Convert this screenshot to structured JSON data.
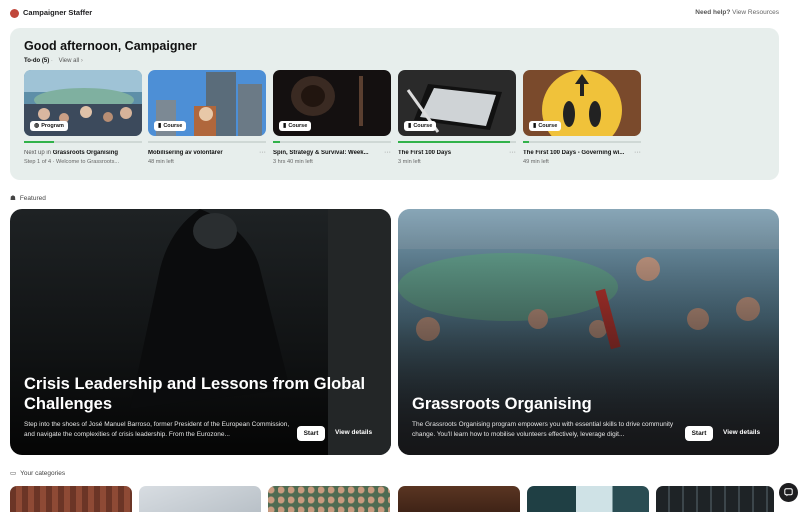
{
  "header": {
    "brand": "Campaigner Staffer",
    "help_prefix": "Need help?",
    "help_link": "View Resources"
  },
  "todo": {
    "greeting": "Good afternoon, Campaigner",
    "title": "To-do (5)",
    "view_all": "View all",
    "items": [
      {
        "badge": "Program",
        "title": "Grassroots Organising",
        "title_prefix": "Next up in ",
        "subtitle": "Step 1 of 4 · Welcome to Grassroots...",
        "progress": 0.25
      },
      {
        "badge": "Course",
        "title": "Mobilisering av volontärer",
        "subtitle": "48 min left",
        "progress": 0
      },
      {
        "badge": "Course",
        "title": "Spin, Strategy & Survival: Week...",
        "subtitle": "3 hrs 40 min left",
        "progress": 0.06
      },
      {
        "badge": "Course",
        "title": "The First 100 Days",
        "subtitle": "3 min left",
        "progress": 0.95
      },
      {
        "badge": "Course",
        "title": "The First 100 Days - Governing wi...",
        "subtitle": "49 min left",
        "progress": 0.05
      }
    ]
  },
  "featured": {
    "label": "Featured",
    "items": [
      {
        "title": "Crisis Leadership and Lessons from Global Challenges",
        "description": "Step into the shoes of José Manuel Barroso, former President of the European Commission, and navigate the complexities of crisis leadership. From the Eurozone...",
        "start": "Start",
        "details": "View details"
      },
      {
        "title": "Grassroots Organising",
        "description": "The Grassroots Organising program empowers you with essential skills to drive community change. You'll learn how to mobilise volunteers effectively, leverage digit...",
        "start": "Start",
        "details": "View details"
      }
    ]
  },
  "categories": {
    "label": "Your categories"
  },
  "icons": {
    "program": "program-icon",
    "course": "bookmark-icon",
    "featured": "medal-icon",
    "categories": "folder-icon",
    "chat": "chat-icon"
  },
  "colors": {
    "progress": "#31b24a",
    "panel": "#e7eeec"
  }
}
